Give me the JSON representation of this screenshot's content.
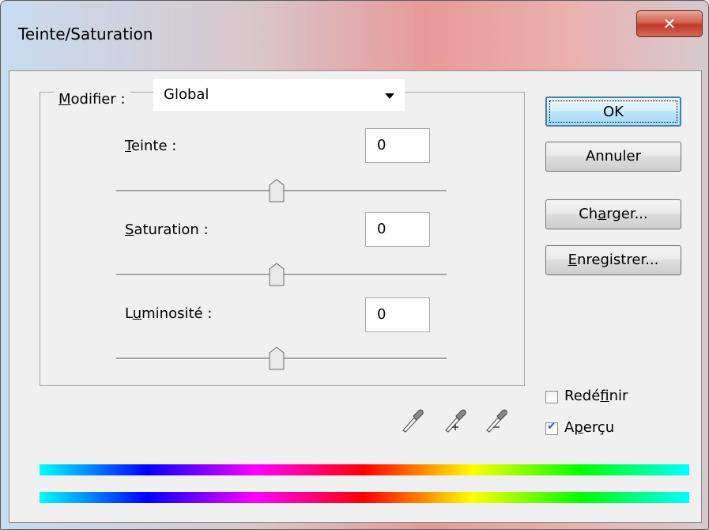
{
  "window": {
    "title": "Teinte/Saturation",
    "close_glyph": "✕"
  },
  "edit": {
    "label_prefix": "M",
    "label_rest": "odifier :",
    "value": "Global"
  },
  "hue": {
    "label_u": "T",
    "label_rest": "einte :",
    "value": "0"
  },
  "saturation": {
    "label_u": "S",
    "label_rest": "aturation :",
    "value": "0"
  },
  "lightness": {
    "label_a": "L",
    "label_u": "u",
    "label_rest": "minosité :",
    "value": "0"
  },
  "buttons": {
    "ok": "OK",
    "cancel": "Annuler",
    "load_a": "Ch",
    "load_u": "a",
    "load_b": "rger...",
    "save_u": "E",
    "save_rest": "nregistrer..."
  },
  "options": {
    "colorize_a": "Redé",
    "colorize_u": "f",
    "colorize_b": "inir",
    "colorize_checked": false,
    "preview_a": "A",
    "preview_u": "p",
    "preview_b": "erçu",
    "preview_checked": true
  },
  "icons": [
    "eyedropper-icon",
    "eyedropper-add-icon",
    "eyedropper-subtract-icon"
  ],
  "colors": {
    "ok_border": "#3c7fb1",
    "spectrum": [
      "#00ffff",
      "#0000ff",
      "#ff00ff",
      "#ff0000",
      "#ffff00",
      "#00ff00",
      "#00ffff"
    ]
  }
}
